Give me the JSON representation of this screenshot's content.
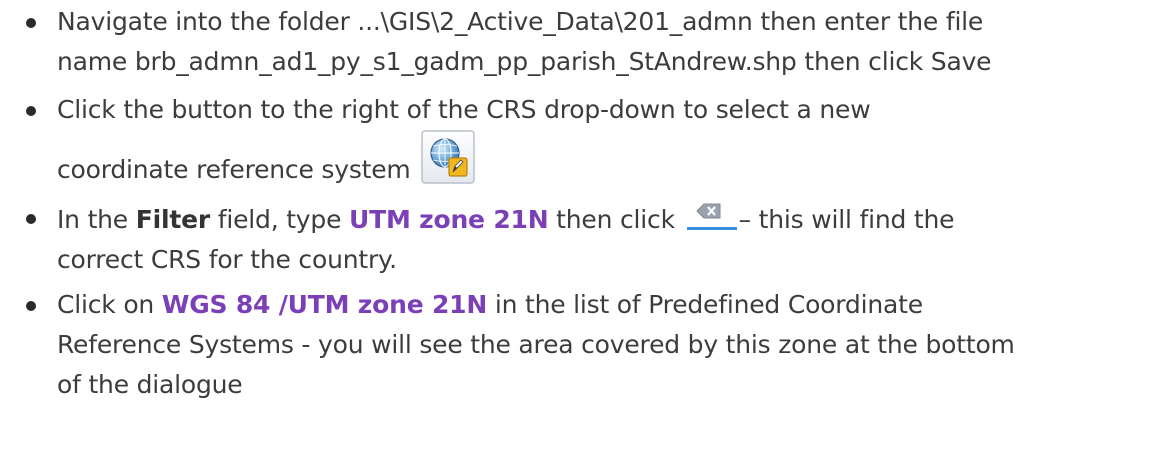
{
  "steps": [
    {
      "line1": "Navigate into the folder ...\\GIS\\2_Active_Data\\201_admn then enter the file",
      "line2": "name brb_admn_ad1_py_s1_gadm_pp_parish_StAndrew.shp then click Save"
    },
    {
      "line1": "Click the button to the right of the CRS drop-down to select a new",
      "line2": "coordinate reference system",
      "icon": "select-crs-globe-icon"
    },
    {
      "pre": "In the ",
      "filter_word": "Filter",
      "mid": " field, type ",
      "search_term": "UTM zone 21N",
      "after_term": " then click ",
      "icon": "clear-filter-icon",
      "post": "– this will find the",
      "line2": "correct CRS for the country."
    },
    {
      "pre": "Click on ",
      "crs_name": "WGS 84 /UTM zone 21N",
      "post": " in the list of Predefined Coordinate",
      "line2": "Reference Systems - you will see the area covered by this zone at the bottom",
      "line3": "of the dialogue"
    }
  ],
  "colors": {
    "text": "#3c3c3c",
    "highlight": "#7b3fb7",
    "bullet": "#2b2b2b"
  }
}
